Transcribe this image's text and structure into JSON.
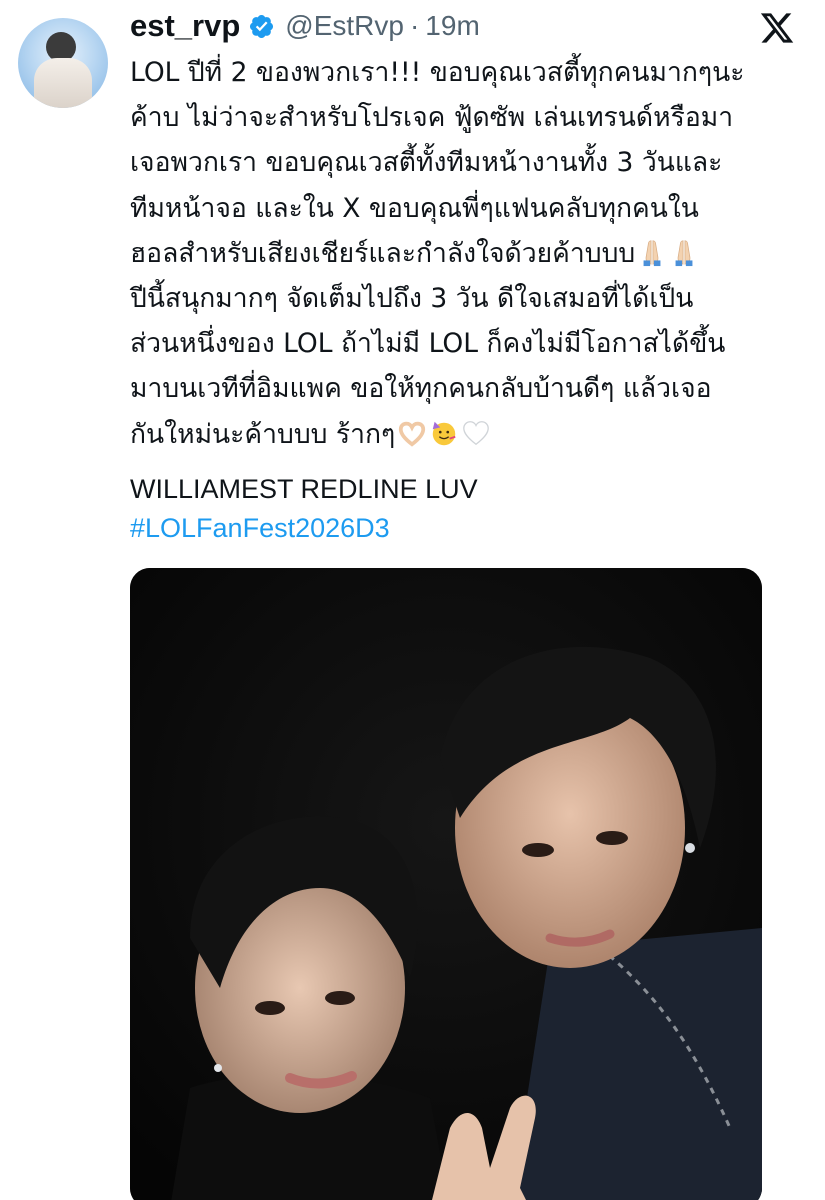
{
  "author": {
    "display_name": "est_rvp",
    "handle": "@EstRvp",
    "separator": "·",
    "time": "19m",
    "verified": true
  },
  "icons": {
    "avatar": "profile-avatar",
    "verified": "verified-badge-icon",
    "brand": "x-logo-icon"
  },
  "colors": {
    "text": "#0f1419",
    "muted": "#536471",
    "link": "#1d9bf0",
    "verified": "#1d9bf0"
  },
  "body": {
    "lines": [
      "LOL ปีที่ 2 ของพวกเรา!!! ขอบคุณเวสตี้ทุกคนมากๆนะ",
      "ค้าบ ไม่ว่าจะสำหรับโปรเจค ฟู้ดซัพ เล่นเทรนด์หรือมา",
      "เจอพวกเรา ขอบคุณเวสตี้ทั้งทีมหน้างานทั้ง 3 วันและ",
      "ทีมหน้าจอ และใน X ขอบคุณพี่ๆแฟนคลับทุกคนใน",
      "ฮอลสำหรับเสียงเชียร์และกำลังใจด้วยค้าบบบ",
      "ปีนี้สนุกมากๆ จัดเต็มไปถึง 3 วัน ดีใจเสมอที่ได้เป็น",
      "ส่วนหนึ่งของ LOL ถ้าไม่มี LOL ก็คงไม่มีโอกาสได้ขึ้น",
      "มาบนเวทีที่อิมแพค ขอให้ทุกคนกลับบ้านดีๆ แล้วเจอ",
      "กันใหม่นะค้าบบบ ร้ากๆ"
    ],
    "emoji_line5": [
      "folded-hands-emoji",
      "folded-hands-emoji"
    ],
    "emoji_line9": [
      "heart-hands-emoji",
      "partying-face-emoji",
      "white-heart-emoji"
    ]
  },
  "signature": "WILLIAMEST REDLINE LUV",
  "hashtag": "#LOLFanFest2026D3",
  "media": {
    "type": "photo",
    "subject": "selfie-photo"
  }
}
